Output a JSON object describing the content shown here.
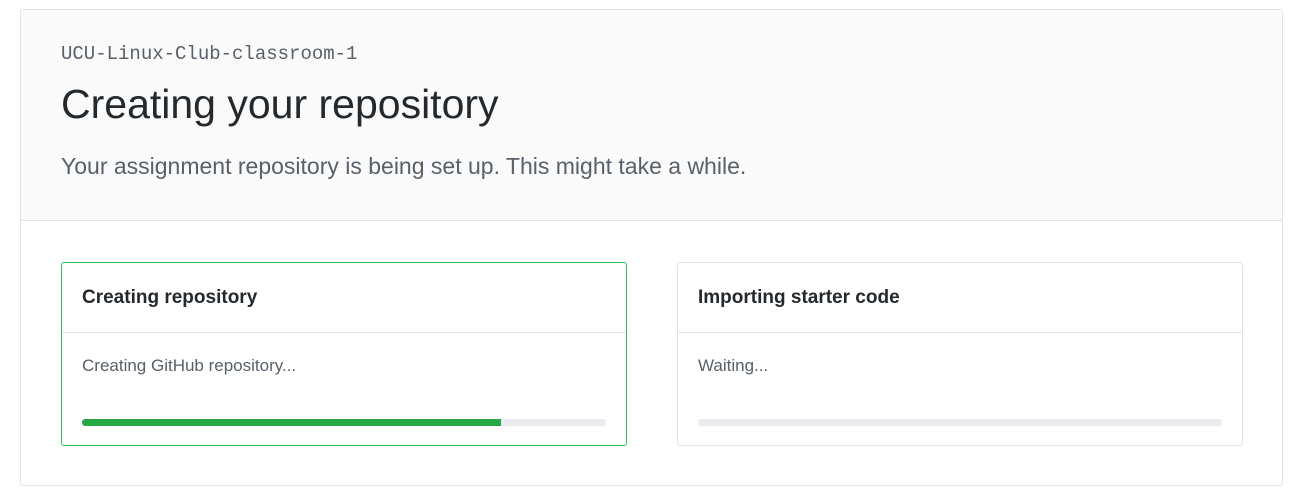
{
  "header": {
    "organization": "UCU-Linux-Club-classroom-1",
    "title": "Creating your repository",
    "subtitle": "Your assignment repository is being set up. This might take a while."
  },
  "steps": [
    {
      "title": "Creating repository",
      "status": "Creating GitHub repository...",
      "progress_fraction": 0.8,
      "active": true
    },
    {
      "title": "Importing starter code",
      "status": "Waiting...",
      "progress_fraction": 0.0,
      "active": false
    }
  ],
  "colors": {
    "accent_green": "#28a745",
    "active_border": "#2cbe4e",
    "track_gray": "#eaecef"
  }
}
